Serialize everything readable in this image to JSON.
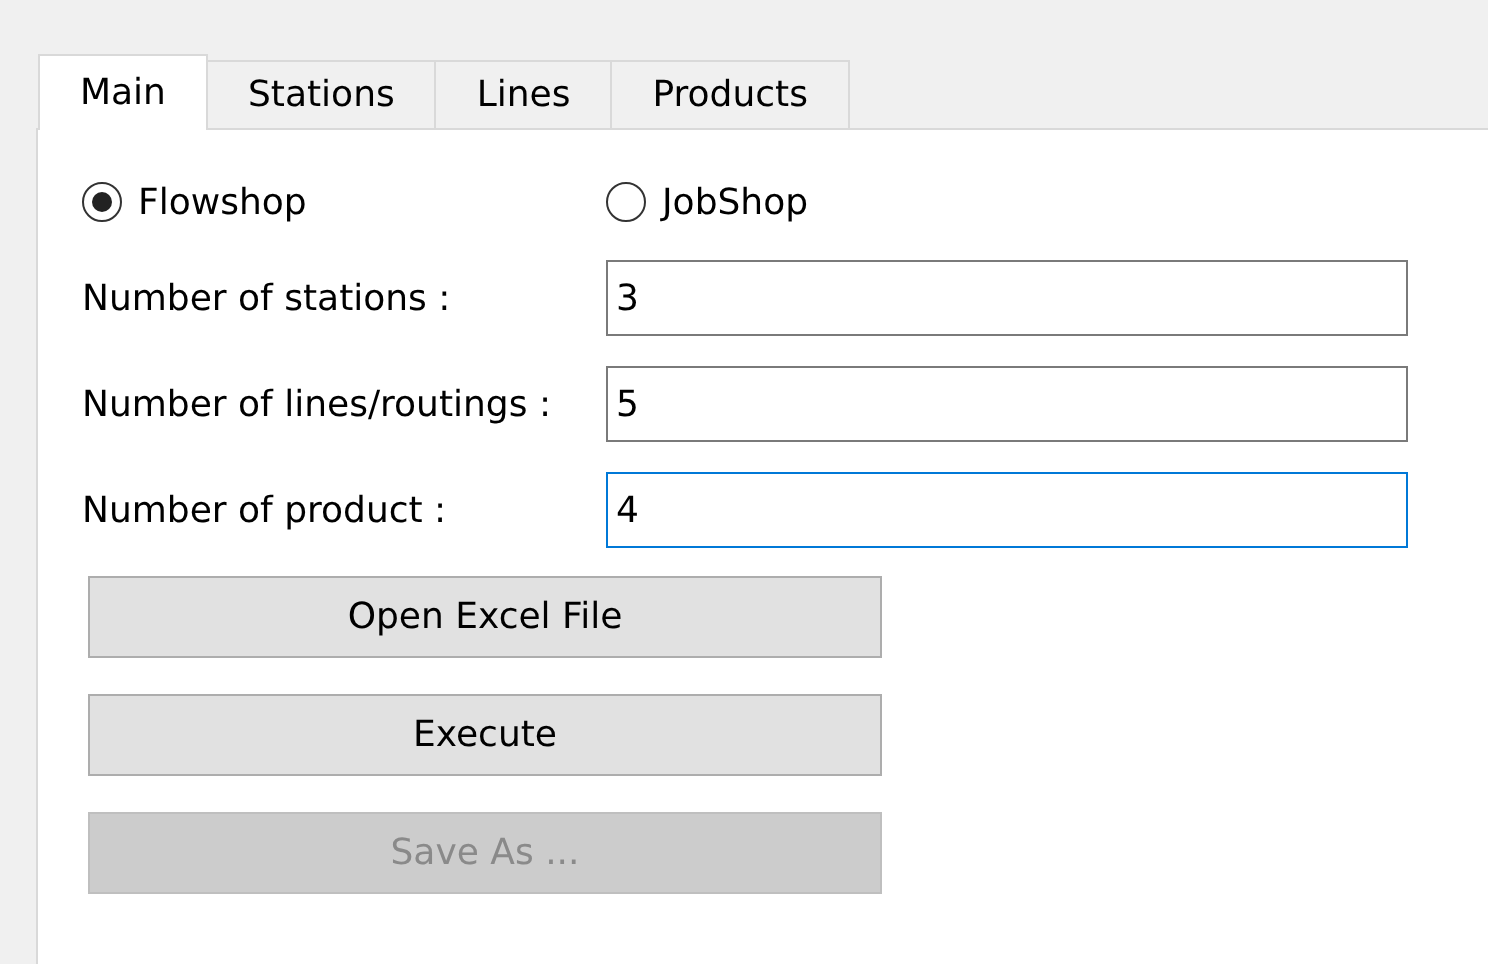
{
  "tabs": [
    {
      "label": "Main",
      "selected": true
    },
    {
      "label": "Stations",
      "selected": false
    },
    {
      "label": "Lines",
      "selected": false
    },
    {
      "label": "Products",
      "selected": false
    }
  ],
  "shop_type": [
    {
      "label": "Flowshop",
      "selected": true
    },
    {
      "label": "JobShop",
      "selected": false
    }
  ],
  "fields": [
    {
      "label": "Number of stations :",
      "value": "3",
      "focused": false
    },
    {
      "label": "Number of lines/routings :",
      "value": "5",
      "focused": false
    },
    {
      "label": "Number of product :",
      "value": "4",
      "focused": true
    }
  ],
  "buttons": [
    {
      "label": "Open Excel File",
      "disabled": false
    },
    {
      "label": "Execute",
      "disabled": false
    },
    {
      "label": "Save As ...",
      "disabled": true
    }
  ]
}
